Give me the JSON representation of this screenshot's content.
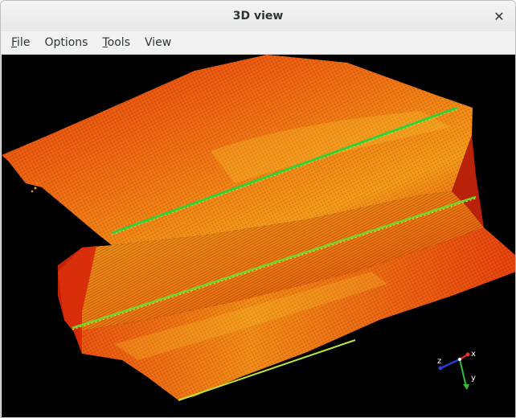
{
  "window": {
    "title": "3D view",
    "close_symbol": "✕"
  },
  "menubar": {
    "items": [
      {
        "label": "File",
        "mnemonic": "F",
        "rest": "ile"
      },
      {
        "label": "Options",
        "mnemonic": "",
        "rest": "Options"
      },
      {
        "label": "Tools",
        "mnemonic": "T",
        "rest": "ools"
      },
      {
        "label": "View",
        "mnemonic": "",
        "rest": "View"
      }
    ]
  },
  "viewport": {
    "background": "#000000",
    "palette": {
      "low": "#e0300a",
      "mid": "#f07a10",
      "high": "#f3b81e",
      "ridge": "#2fd13a"
    },
    "axes": {
      "x": "x",
      "y": "y",
      "z": "z"
    },
    "axis_colors": {
      "x": "#e8302a",
      "y": "#2fbf3a",
      "z": "#2b3fd6"
    }
  }
}
